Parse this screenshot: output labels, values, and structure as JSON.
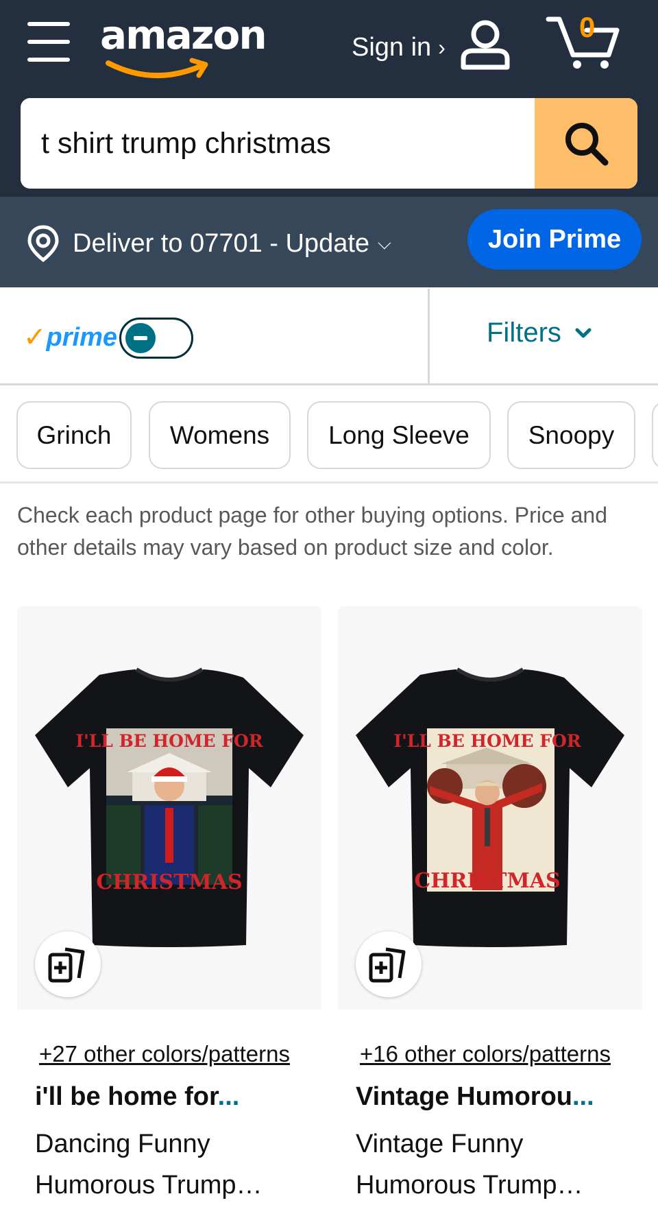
{
  "header": {
    "logo_text": "amazon",
    "signin_label": "Sign in",
    "signin_chevron": "›",
    "cart_count": "0",
    "icons": [
      "menu-icon",
      "user-icon",
      "cart-icon",
      "search-icon"
    ],
    "colors": {
      "bar": "#232f3e",
      "accent": "#ff9900",
      "search_button": "#febd69"
    }
  },
  "search": {
    "value": "t shirt trump christmas"
  },
  "deliver": {
    "label": "Deliver to 07701 - Update",
    "caret": "⌵",
    "icon": "location-pin-icon"
  },
  "join_prime": {
    "label": "Join Prime",
    "color": "#0066e6"
  },
  "prime_filter": {
    "check": "✓",
    "logo": "prime",
    "toggle_state": "off"
  },
  "filters": {
    "label": "Filters",
    "icon": "chevron-down-icon"
  },
  "chips": [
    "Grinch",
    "Womens",
    "Long Sleeve",
    "Snoopy"
  ],
  "notice": "Check each product page for other buying options. Price and other details may vary based on product size and color.",
  "products": [
    {
      "colors_link": "+27 other colors/patterns",
      "brand": "i'll be home for",
      "brand_more": "...",
      "title_line1": "Dancing Funny",
      "title_line2": "Humorous Trump…",
      "shirt_top": "I'LL BE HOME FOR",
      "shirt_bottom": "CHRISTMAS"
    },
    {
      "colors_link": "+16 other colors/patterns",
      "brand": "Vintage Humorou",
      "brand_more": "...",
      "title_line1": "Vintage Funny",
      "title_line2": "Humorous Trump…",
      "shirt_top": "I'LL BE HOME FOR",
      "shirt_bottom": "CHRISTMAS"
    }
  ]
}
